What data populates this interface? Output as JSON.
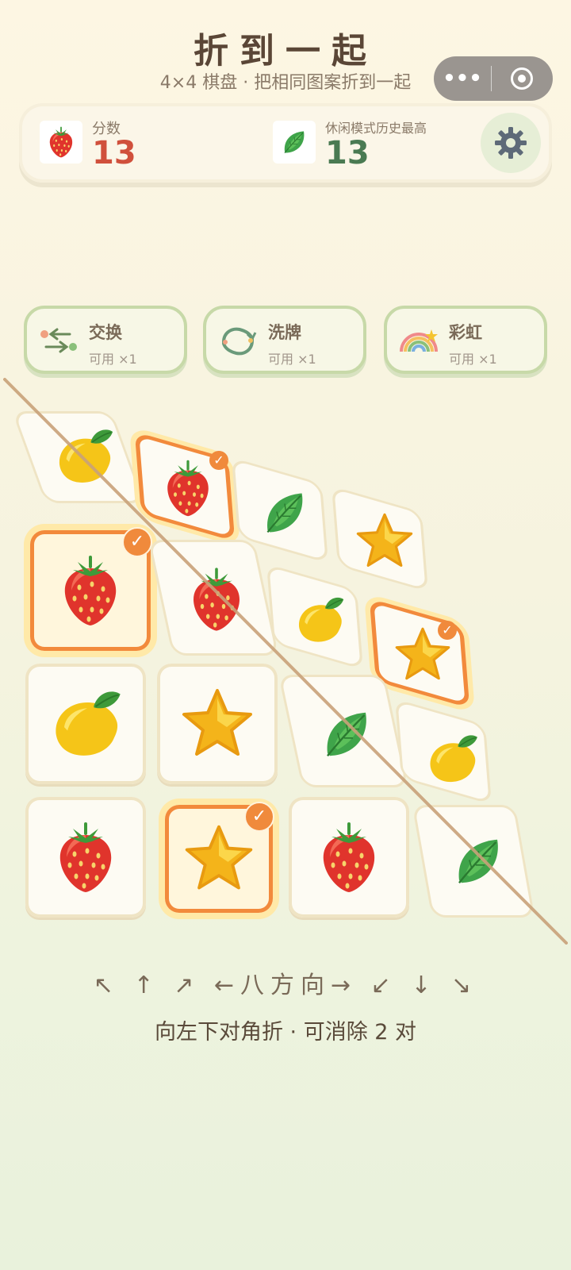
{
  "header": {
    "title": "折到一起",
    "subtitle": "4×4 棋盘 · 把相同图案折到一起"
  },
  "capsule": {
    "more_label": "•••"
  },
  "scores": {
    "current_label": "分数",
    "current_value": "13",
    "best_label": "休闲模式历史最高",
    "best_value": "13"
  },
  "tools": [
    {
      "name": "交换",
      "count": "可用 ×1",
      "icon": "swap-icon"
    },
    {
      "name": "洗牌",
      "count": "可用 ×1",
      "icon": "shuffle-icon"
    },
    {
      "name": "彩虹",
      "count": "可用 ×1",
      "icon": "rainbow-icon"
    }
  ],
  "board": {
    "size": "4×4",
    "cells": [
      [
        "lemon",
        "strawberry",
        "leaf",
        "star"
      ],
      [
        "strawberry",
        "strawberry",
        "lemon",
        "star"
      ],
      [
        "lemon",
        "star",
        "leaf",
        "lemon"
      ],
      [
        "strawberry",
        "star",
        "strawberry",
        "leaf"
      ]
    ],
    "selected_marks": [
      "✓",
      "✓",
      "✓",
      "✓"
    ]
  },
  "directions": {
    "arrows": "↖ ↑ ↗ ←八方向→ ↙ ↓ ↘"
  },
  "hint": "向左下对角折 · 可消除 2 对",
  "colors": {
    "score_red": "#d0503c",
    "best_green": "#4a7a52",
    "select_orange": "#f28a3c",
    "fold_line": "#c9a27a"
  }
}
